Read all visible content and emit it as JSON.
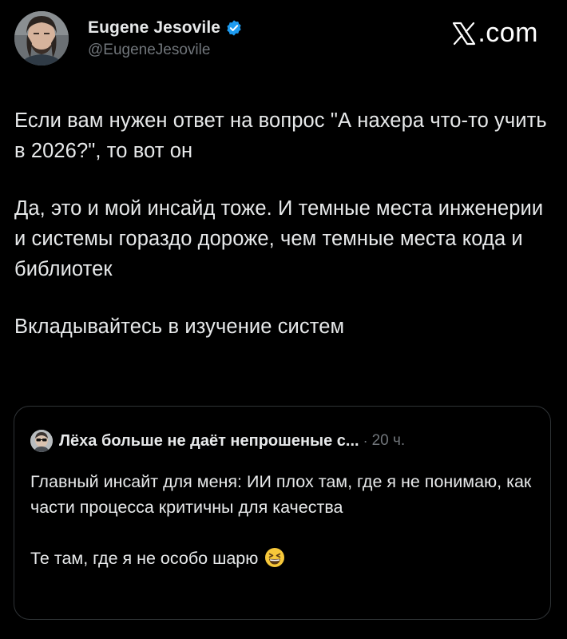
{
  "author": {
    "name": "Eugene Jesovile",
    "handle": "@EugeneJesovile",
    "verified": true
  },
  "brand": {
    "icon": "x-logo-icon",
    "suffix": ".com"
  },
  "tweet": {
    "paragraphs": [
      "Если вам нужен ответ на вопрос \"А нахера что-то учить в 2026?\", то вот он",
      "Да, это и мой инсайд тоже. И темные места инженерии и системы гораздо дороже, чем темные места кода и библиотек",
      "Вкладывайтесь в изучение систем"
    ]
  },
  "quote": {
    "author_name": "Лёха больше не даёт непрошеные с...",
    "separator": "·",
    "time": "20 ч.",
    "paragraphs": [
      "Главный инсайт для меня: ИИ плох там, где я не понимаю, как части процесса критичны для качества",
      "Те там, где я не особо шарю"
    ],
    "emoji": "grinning-squinting-face-emoji"
  },
  "colors": {
    "background": "#000000",
    "text": "#e7e9ea",
    "muted": "#71767b",
    "border": "#2f3336",
    "verified": "#1d9bf0"
  }
}
